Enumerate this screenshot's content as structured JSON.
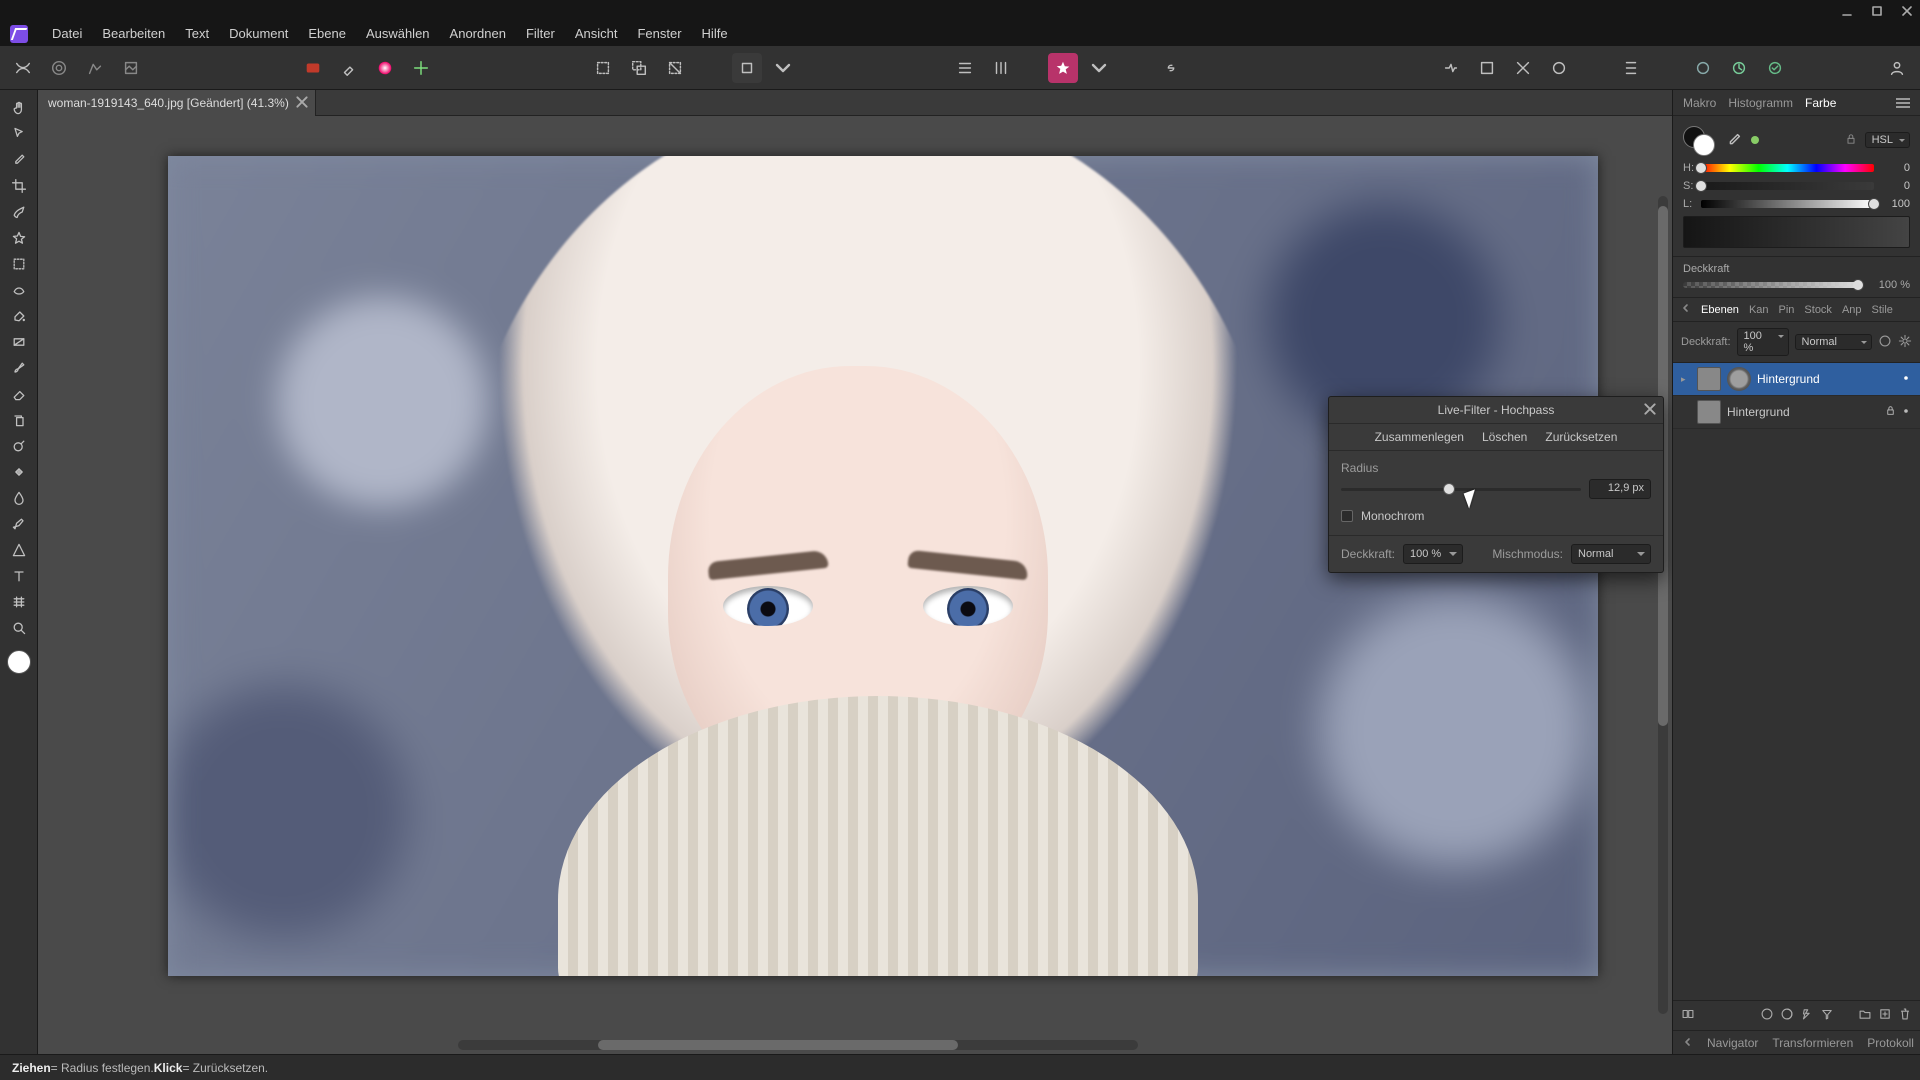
{
  "menu": {
    "items": [
      "Datei",
      "Bearbeiten",
      "Text",
      "Dokument",
      "Ebene",
      "Auswählen",
      "Anordnen",
      "Filter",
      "Ansicht",
      "Fenster",
      "Hilfe"
    ]
  },
  "document": {
    "tab_title": "woman-1919143_640.jpg [Geändert] (41.3%)"
  },
  "dialog": {
    "title": "Live-Filter - Hochpass",
    "actions": {
      "merge": "Zusammenlegen",
      "delete": "Löschen",
      "reset": "Zurücksetzen"
    },
    "radius_label": "Radius",
    "radius_value": "12,9 px",
    "radius_percent": 45,
    "monochrome_label": "Monochrom",
    "opacity_label": "Deckkraft:",
    "opacity_value": "100 %",
    "blendmode_label": "Mischmodus:",
    "blendmode_value": "Normal"
  },
  "color_panel": {
    "tabs": {
      "makro": "Makro",
      "histogramm": "Histogramm",
      "farbe": "Farbe"
    },
    "mode": "HSL",
    "h": {
      "label": "H:",
      "value": "0",
      "percent": 0
    },
    "s": {
      "label": "S:",
      "value": "0",
      "percent": 0
    },
    "l": {
      "label": "L:",
      "value": "100",
      "percent": 100
    },
    "opacity_label": "Deckkraft",
    "opacity_value": "100 %"
  },
  "layers_panel": {
    "tabs": {
      "ebenen": "Ebenen",
      "kan": "Kan",
      "pin": "Pin",
      "stock": "Stock",
      "anp": "Anp",
      "stile": "Stile"
    },
    "opacity_label": "Deckkraft:",
    "opacity_value": "100 %",
    "blendmode_value": "Normal",
    "items": [
      {
        "name": "Hintergrund",
        "selected": true,
        "has_fx_thumb": true
      },
      {
        "name": "Hintergrund",
        "selected": false,
        "has_fx_thumb": false
      }
    ]
  },
  "bottom_tabs": {
    "navigator": "Navigator",
    "transformieren": "Transformieren",
    "protokoll": "Protokoll"
  },
  "status": {
    "drag_label": "Ziehen",
    "drag_action": " = Radius festlegen. ",
    "click_label": "Klick",
    "click_action": " = Zurücksetzen."
  }
}
